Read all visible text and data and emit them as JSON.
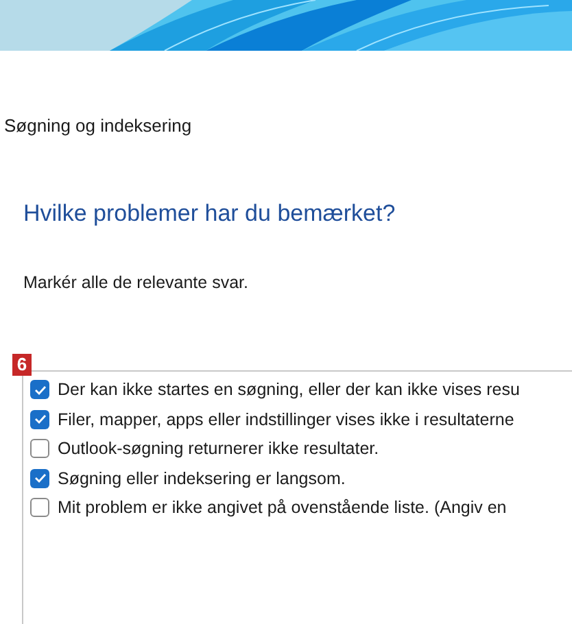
{
  "window": {
    "title": "Søgning og indeksering"
  },
  "heading": "Hvilke problemer har du bemærket?",
  "instruction": "Markér alle de relevante svar.",
  "badge": "6",
  "options": [
    {
      "label": "Der kan ikke startes en søgning, eller der kan ikke vises resu",
      "checked": true
    },
    {
      "label": "Filer, mapper, apps eller indstillinger vises ikke i resultaterne",
      "checked": true
    },
    {
      "label": "Outlook-søgning returnerer ikke resultater.",
      "checked": false
    },
    {
      "label": "Søgning eller indeksering er langsom.",
      "checked": true
    },
    {
      "label": "Mit problem er ikke angivet på ovenstående liste. (Angiv en",
      "checked": false
    }
  ]
}
